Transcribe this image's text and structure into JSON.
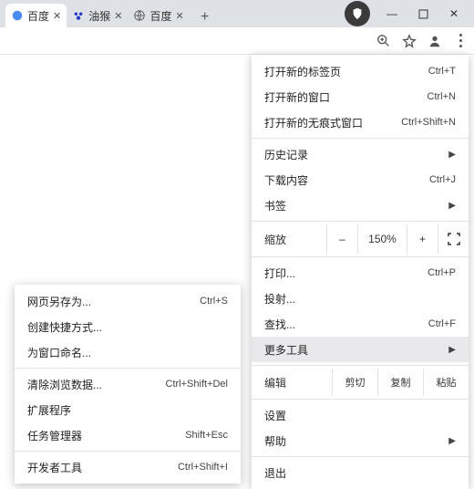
{
  "tabs": [
    {
      "title": "百度",
      "icon": "baidu"
    },
    {
      "title": "油猴",
      "icon": "baidu-paw"
    },
    {
      "title": "百度",
      "icon": "globe"
    }
  ],
  "wincontrols": {
    "minimize": "—",
    "maximize": "□",
    "close": "✕"
  },
  "menu": {
    "new_tab": {
      "label": "打开新的标签页",
      "shortcut": "Ctrl+T"
    },
    "new_window": {
      "label": "打开新的窗口",
      "shortcut": "Ctrl+N"
    },
    "new_incognito": {
      "label": "打开新的无痕式窗口",
      "shortcut": "Ctrl+Shift+N"
    },
    "history": {
      "label": "历史记录"
    },
    "downloads": {
      "label": "下载内容",
      "shortcut": "Ctrl+J"
    },
    "bookmarks": {
      "label": "书签"
    },
    "zoom": {
      "label": "缩放",
      "minus": "–",
      "value": "150%",
      "plus": "+"
    },
    "print": {
      "label": "打印...",
      "shortcut": "Ctrl+P"
    },
    "cast": {
      "label": "投射..."
    },
    "find": {
      "label": "查找...",
      "shortcut": "Ctrl+F"
    },
    "more_tools": {
      "label": "更多工具"
    },
    "edit": {
      "label": "编辑",
      "cut": "剪切",
      "copy": "复制",
      "paste": "粘贴"
    },
    "settings": {
      "label": "设置"
    },
    "help": {
      "label": "帮助"
    },
    "exit": {
      "label": "退出"
    }
  },
  "submenu": {
    "save_as": {
      "label": "网页另存为...",
      "shortcut": "Ctrl+S"
    },
    "create_shortcut": {
      "label": "创建快捷方式..."
    },
    "name_window": {
      "label": "为窗口命名..."
    },
    "clear_data": {
      "label": "清除浏览数据...",
      "shortcut": "Ctrl+Shift+Del"
    },
    "extensions": {
      "label": "扩展程序"
    },
    "task_manager": {
      "label": "任务管理器",
      "shortcut": "Shift+Esc"
    },
    "dev_tools": {
      "label": "开发者工具",
      "shortcut": "Ctrl+Shift+I"
    }
  }
}
